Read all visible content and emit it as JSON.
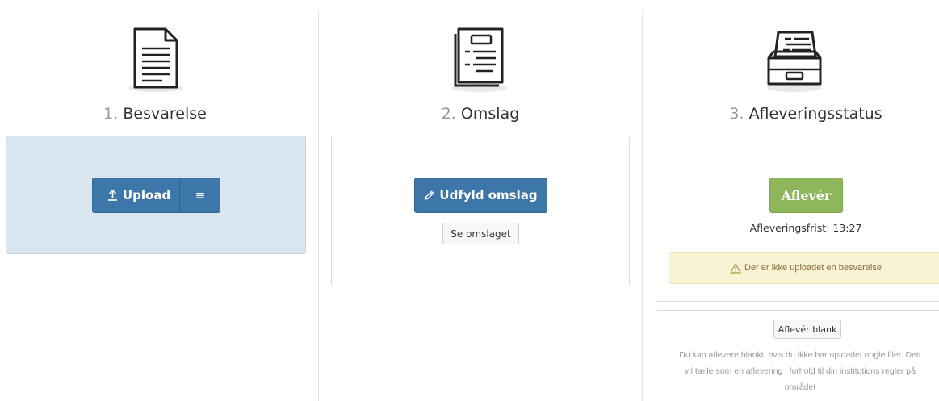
{
  "steps": [
    {
      "number": "1.",
      "title": "Besvarelse"
    },
    {
      "number": "2.",
      "title": "Omslag"
    },
    {
      "number": "3.",
      "title": "Afleveringsstatus"
    }
  ],
  "besvarelse": {
    "upload_label": "Upload",
    "menu_glyph": "≡"
  },
  "omslag": {
    "fill_label": "Udfyld omslag",
    "view_label": "Se omslaget"
  },
  "status": {
    "submit_label": "Aflevér",
    "deadline": "Afleveringsfrist: 13:27",
    "warning": "Der er ikke uploadet en besvarelse",
    "submit_blank_label": "Aflevér blank",
    "blank_help_line1": "Du kan aflevere blankt, hvis du ikke har uploadet nogle filer. Dett",
    "blank_help_line2": "vil tælle som en aflevering i forhold til din institutions regler på",
    "blank_help_line3": "området"
  },
  "icons": {
    "step1": "document-icon",
    "step2": "cover-folder-icon",
    "step3": "inbox-tray-icon",
    "upload": "upload-icon",
    "menu": "menu-icon",
    "pencil": "pencil-icon",
    "warning": "warning-icon"
  },
  "colors": {
    "primary": "#3d76a8",
    "success": "#8db65a",
    "upload_panel": "#d9e6f0",
    "alert_bg": "#f8f3d4",
    "alert_text": "#8a6d3b"
  }
}
